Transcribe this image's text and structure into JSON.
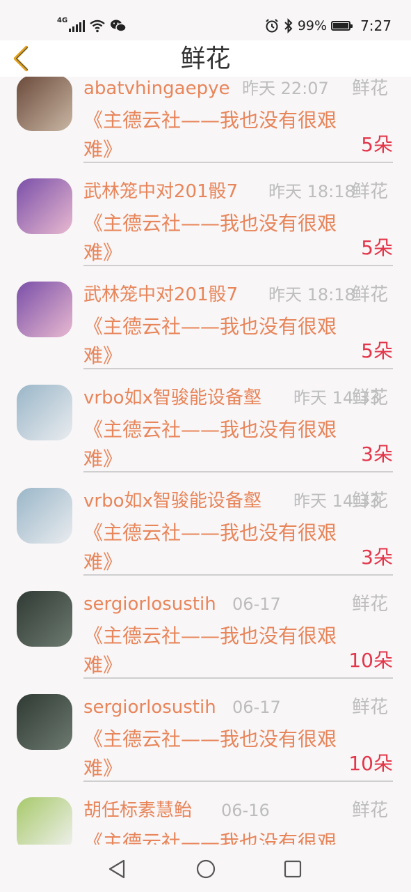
{
  "status_bar": {
    "network": "4G",
    "battery": "99%",
    "battery_level": 0.99,
    "time": "7:27"
  },
  "header": {
    "title": "鲜花"
  },
  "items": [
    {
      "name": "abatvhingaepye",
      "time": "昨天 22:07",
      "type": "鲜花",
      "content": "《主德云社——我也没有很艰难》",
      "count": "5朵",
      "avatar_colors": [
        "#6b4a3a",
        "#c9b6a4"
      ]
    },
    {
      "name": "武林笼中对201骰7",
      "time": "昨天 18:18",
      "type": "鲜花",
      "content": "《主德云社——我也没有很艰难》",
      "count": "5朵",
      "avatar_colors": [
        "#7a4fa8",
        "#e8b9d0"
      ]
    },
    {
      "name": "武林笼中对201骰7",
      "time": "昨天 18:18",
      "type": "鲜花",
      "content": "《主德云社——我也没有很艰难》",
      "count": "5朵",
      "avatar_colors": [
        "#7a4fa8",
        "#e8b9d0"
      ]
    },
    {
      "name": "vrbo如x智骏能设备壑",
      "time": "昨天 14:33",
      "type": "鲜花",
      "content": "《主德云社——我也没有很艰难》",
      "count": "3朵",
      "avatar_colors": [
        "#9ab6c8",
        "#e9ecef"
      ]
    },
    {
      "name": "vrbo如x智骏能设备壑",
      "time": "昨天 14:33",
      "type": "鲜花",
      "content": "《主德云社——我也没有很艰难》",
      "count": "3朵",
      "avatar_colors": [
        "#9ab6c8",
        "#e9ecef"
      ]
    },
    {
      "name": "sergiorlosustih",
      "time": "06-17",
      "type": "鲜花",
      "content": "《主德云社——我也没有很艰难》",
      "count": "10朵",
      "avatar_colors": [
        "#2e3a33",
        "#6d7a70"
      ]
    },
    {
      "name": "sergiorlosustih",
      "time": "06-17",
      "type": "鲜花",
      "content": "《主德云社——我也没有很艰难》",
      "count": "10朵",
      "avatar_colors": [
        "#2e3a33",
        "#6d7a70"
      ]
    },
    {
      "name": "胡任标素慧鲐",
      "time": "06-16",
      "type": "鲜花",
      "content": "《主德云社——我也没有很艰难》",
      "count": "",
      "avatar_colors": [
        "#a7c96a",
        "#f2f2f2"
      ]
    }
  ],
  "colors": {
    "accent": "#e8855a",
    "count": "#e3364a",
    "muted": "#bdbdbd",
    "back_arrow": "#e3a21a"
  }
}
